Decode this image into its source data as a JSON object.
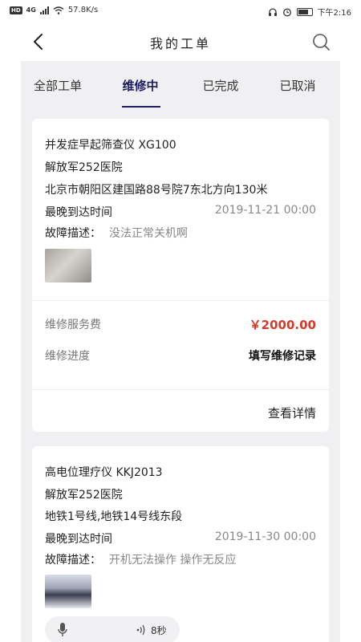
{
  "status_bar": {
    "speed": "57.8K/s",
    "network": "4G",
    "time": "下午2:16"
  },
  "nav": {
    "title": "我的工单"
  },
  "tabs": [
    {
      "label": "全部工单",
      "active": false
    },
    {
      "label": "维修中",
      "active": true
    },
    {
      "label": "已完成",
      "active": false
    },
    {
      "label": "已取消",
      "active": false
    }
  ],
  "orders": [
    {
      "device": "并发症早起筛查仪 XG100",
      "hospital": "解放军252医院",
      "address": "北京市朝阳区建国路88号院7东北方向130米",
      "arrival_label": "最晚到达时间",
      "arrival_time": "2019-11-21 00:00",
      "fault_label": "故障描述：",
      "fault_text": "没法正常关机啊",
      "fee_label": "维修服务费",
      "fee_value": "￥2000.00",
      "progress_label": "维修进度",
      "progress_action": "填写维修记录",
      "detail_label": "查看详情"
    },
    {
      "device": "高电位理疗仪 KKJ2013",
      "hospital": "解放军252医院",
      "address": "地铁1号线,地铁14号线东段",
      "arrival_label": "最晚到达时间",
      "arrival_time": "2019-11-30 00:00",
      "fault_label": "故障描述：",
      "fault_text": "开机无法操作 操作无反应",
      "voice_duration": "8秒"
    }
  ]
}
